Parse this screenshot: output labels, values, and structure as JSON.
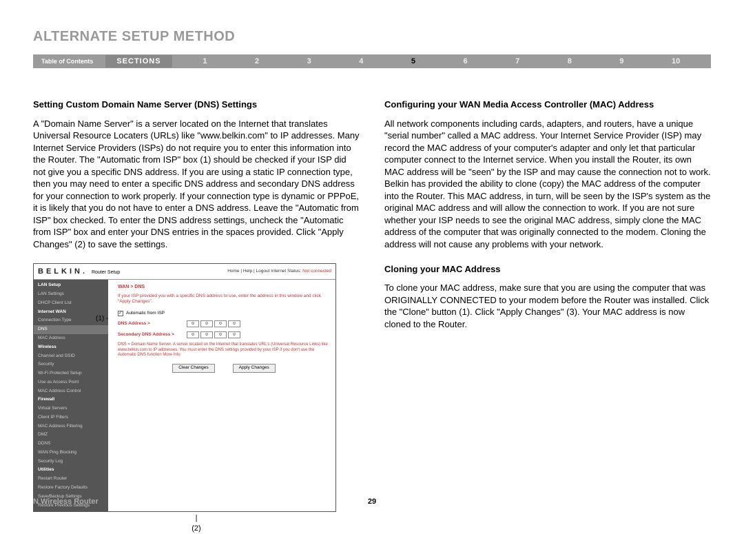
{
  "pageTitle": "ALTERNATE SETUP METHOD",
  "nav": {
    "toc": "Table of Contents",
    "sectionsLabel": "SECTIONS",
    "numbers": [
      "1",
      "2",
      "3",
      "4",
      "5",
      "6",
      "7",
      "8",
      "9",
      "10"
    ],
    "activeIndex": 4
  },
  "left": {
    "heading": "Setting Custom Domain Name Server (DNS) Settings",
    "body": "A \"Domain Name Server\" is a server located on the Internet that translates Universal Resource Locaters (URLs) like \"www.belkin.com\" to IP addresses. Many Internet Service Providers (ISPs) do not require you to enter this information into the Router. The \"Automatic from ISP\" box (1) should be checked if your ISP did not give you a specific DNS address. If you are using a static IP connection type, then you may need to enter a specific DNS address and secondary DNS address for your connection to work properly. If your connection type is dynamic or PPPoE, it is likely that you do not have to enter a DNS address. Leave the \"Automatic from ISP\" box checked. To enter the DNS address settings, uncheck the \"Automatic from ISP\" box and enter your DNS entries in the spaces provided. Click \"Apply Changes\" (2) to save the settings."
  },
  "right": {
    "heading1": "Configuring your WAN Media Access Controller (MAC) Address",
    "body1": "All network components including cards, adapters, and routers, have a unique \"serial number\" called a MAC address. Your Internet Service Provider (ISP) may record the MAC address of your computer's adapter and only let that particular computer connect to the Internet service. When you install the Router, its own MAC address will be \"seen\" by the ISP and may cause the connection not to work. Belkin has provided the ability to clone (copy) the MAC address of the computer into the Router. This MAC address, in turn, will be seen by the ISP's system as the original MAC address and will allow the connection to work. If you are not sure whether your ISP needs to see the original MAC address, simply clone the MAC address of the computer that was originally connected to the modem. Cloning the address will not cause any problems with your network.",
    "heading2": "Cloning your MAC Address",
    "body2": "To clone your MAC address, make sure that you are using the computer that was ORIGINALLY CONNECTED to your modem before the Router was installed. Click the \"Clone\" button (1). Click \"Apply Changes\" (3). Your MAC address is now cloned to the Router."
  },
  "screenshot": {
    "logo": "BELKIN.",
    "logoSub": "Router Setup",
    "topLinks": "Home | Help | Logout  Internet Status:",
    "notConnected": "Not connected",
    "breadcrumb": "WAN > DNS",
    "instr": "If your ISP provided you with a specific DNS address to use, enter the address in this window and click \"Apply Changes\".",
    "autoLabel": "Automatic from ISP",
    "dnsLabel": "DNS Address >",
    "secDnsLabel": "Secondary DNS Address >",
    "dnsVal": "0",
    "note": "DNS = Domain Name Server. A server located on the Internet that translates URL's (Universal Resource Links) like www.belkin.com to IP addresses. You must enter the DNS settings provided by your ISP if you don't use the Automatic DNS function More Info",
    "clearBtn": "Clear Changes",
    "applyBtn": "Apply Changes",
    "callout1": "(1) -",
    "callout2": "(2)",
    "sidebar": {
      "cat1": "LAN Setup",
      "i1": "LAN Settings",
      "i2": "DHCP Client List",
      "cat2": "Internet WAN",
      "i3": "Connection Type",
      "i4": "DNS",
      "i5": "MAC Address",
      "cat3": "Wireless",
      "i6": "Channel and SSID",
      "i7": "Security",
      "i8": "Wi-Fi Protected Setup",
      "i9": "Use as Access Point",
      "i10": "MAC Address Control",
      "cat4": "Firewall",
      "i11": "Virtual Servers",
      "i12": "Client IP Filters",
      "i13": "MAC Address Filtering",
      "i14": "DMZ",
      "i15": "DDNS",
      "i16": "WAN Ping Blocking",
      "i17": "Security Log",
      "cat5": "Utilities",
      "i18": "Restart Router",
      "i19": "Restore Factory Defaults",
      "i20": "Save/Backup Settings",
      "i21": "Restore Previous Settings"
    }
  },
  "footer": {
    "product": "N Wireless Router",
    "page": "29"
  }
}
